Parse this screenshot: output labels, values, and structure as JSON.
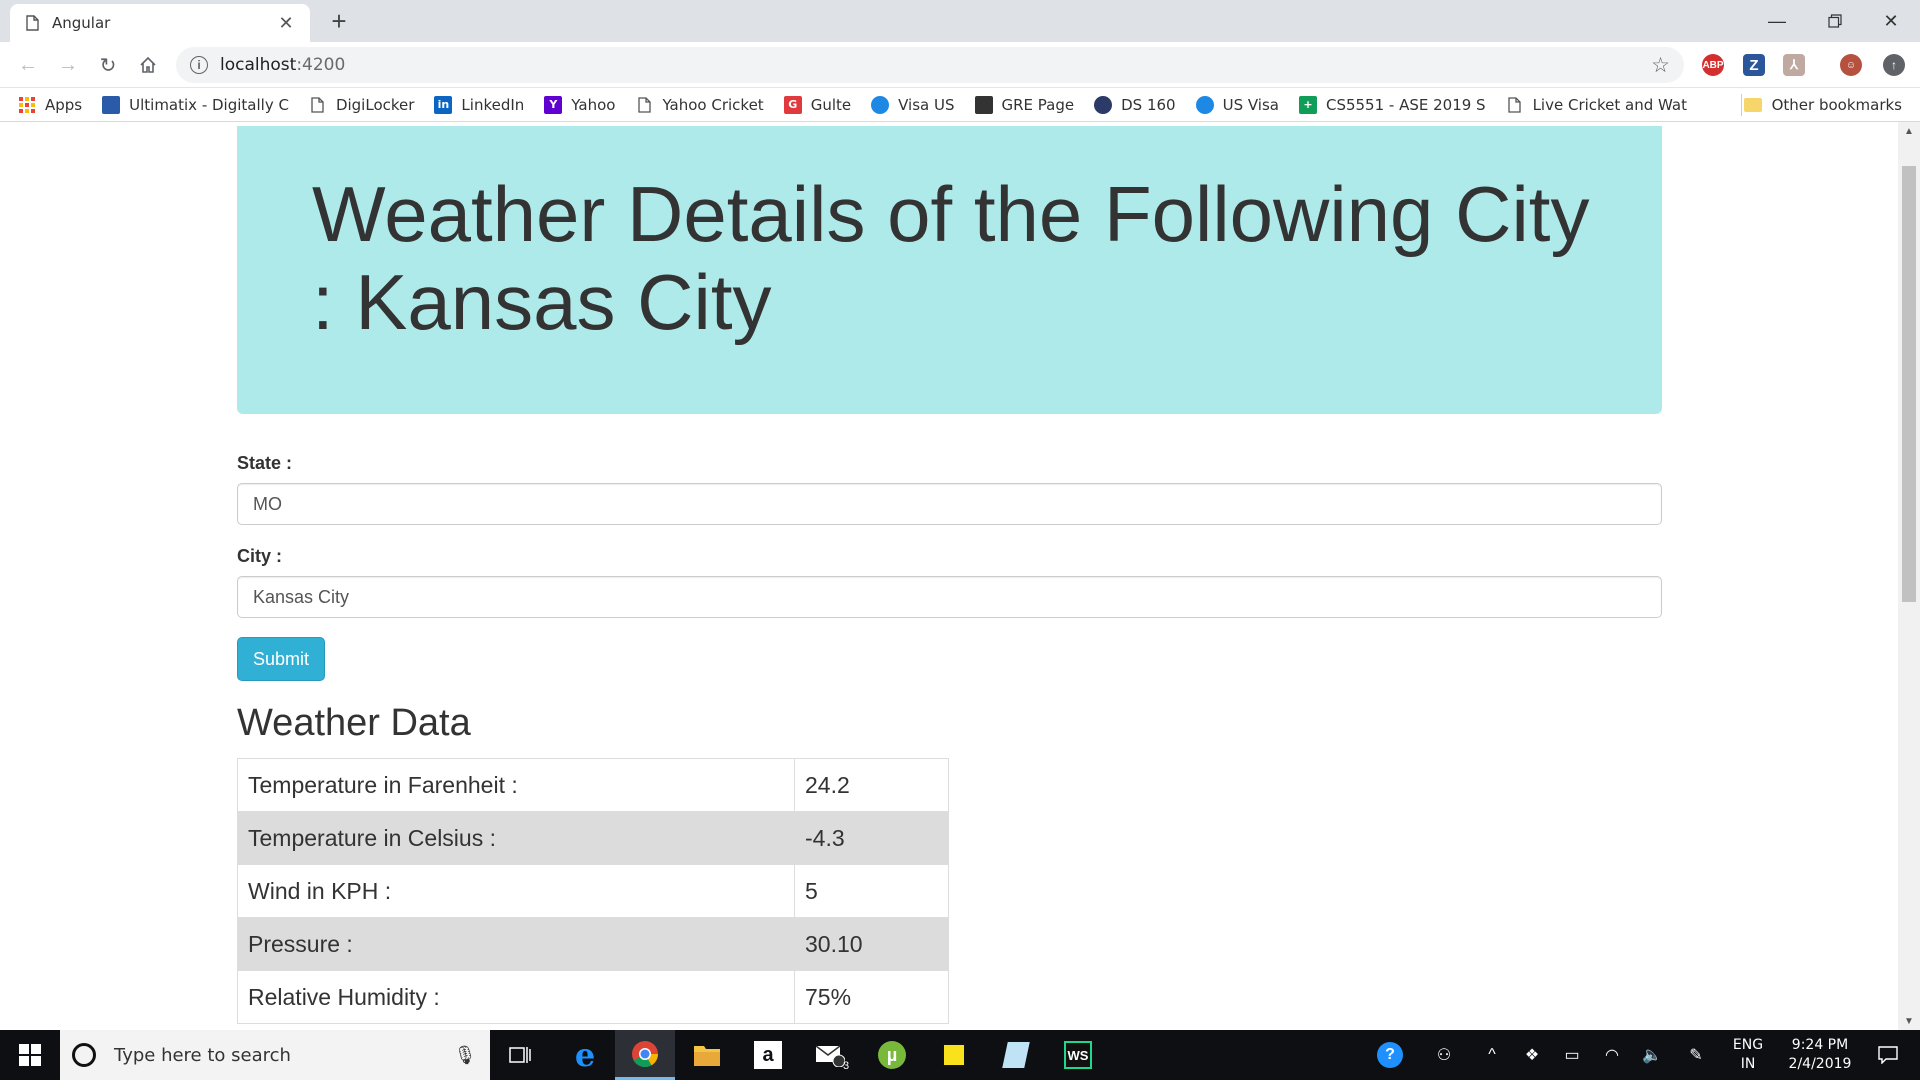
{
  "browser": {
    "tab_title": "Angular",
    "url_host": "localhost",
    "url_port": ":4200",
    "bookmarks": [
      {
        "label": "Apps",
        "icon": "apps-grid-icon",
        "color": "#4285f4"
      },
      {
        "label": "Ultimatix - Digitally C",
        "icon": "tata-icon",
        "color": "#2a5aa8"
      },
      {
        "label": "DigiLocker",
        "icon": "page-icon",
        "color": ""
      },
      {
        "label": "LinkedIn",
        "icon": "linkedin-icon",
        "color": "#0a66c2"
      },
      {
        "label": "Yahoo",
        "icon": "yahoo-icon",
        "color": "#5f01d1"
      },
      {
        "label": "Yahoo Cricket",
        "icon": "page-icon",
        "color": ""
      },
      {
        "label": "Gulte",
        "icon": "gulte-icon",
        "color": "#e03a3e"
      },
      {
        "label": "Visa US",
        "icon": "cloud-icon",
        "color": "#1e88e5"
      },
      {
        "label": "GRE Page",
        "icon": "ets-icon",
        "color": "#333333"
      },
      {
        "label": "DS 160",
        "icon": "seal-icon",
        "color": "#2b3a67"
      },
      {
        "label": "US Visa",
        "icon": "cloud-icon",
        "color": "#1e88e5"
      },
      {
        "label": "CS5551 - ASE 2019 S",
        "icon": "sheets-icon",
        "color": "#0f9d58"
      },
      {
        "label": "Live Cricket and Wat",
        "icon": "page-icon",
        "color": ""
      }
    ],
    "other_bookmarks": "Other bookmarks"
  },
  "page": {
    "title": "Weather Details of the Following City : Kansas City",
    "state_label": "State :",
    "state_value": "MO",
    "city_label": "City :",
    "city_value": "Kansas City",
    "submit_label": "Submit",
    "section_title": "Weather Data",
    "weather_rows": [
      {
        "label": "Temperature in Farenheit :",
        "value": "24.2"
      },
      {
        "label": "Temperature in Celsius :",
        "value": "-4.3"
      },
      {
        "label": "Wind in KPH :",
        "value": "5"
      },
      {
        "label": "Pressure :",
        "value": "30.10"
      },
      {
        "label": "Relative Humidity :",
        "value": "75%"
      }
    ]
  },
  "taskbar": {
    "search_placeholder": "Type here to search",
    "lang_line1": "ENG",
    "lang_line2": "IN",
    "time": "9:24 PM",
    "date": "2/4/2019",
    "mail_badge": "3"
  },
  "colors": {
    "jumbotron": "#afeaeb",
    "submit": "#31b0d5",
    "row_alt": "#dcdcdc"
  }
}
